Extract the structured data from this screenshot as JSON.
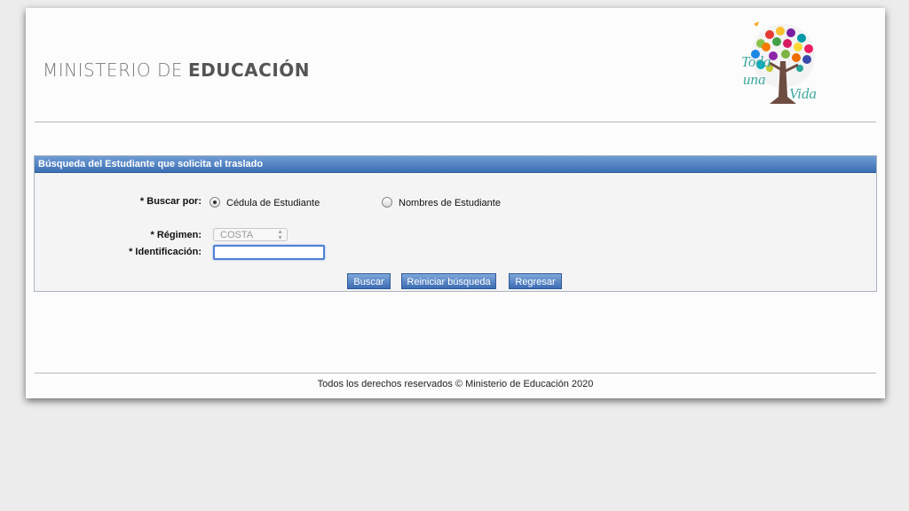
{
  "header": {
    "brand_light": "MINISTERIO DE",
    "brand_bold": "EDUCACIÓN",
    "logo_text_1": "Toda",
    "logo_text_2": "una",
    "logo_text_3": "Vida",
    "logo_icon": "tree-logo-icon"
  },
  "form": {
    "title": "Búsqueda del Estudiante que solicita el traslado",
    "buscar_por_label": "* Buscar por:",
    "radio_cedula": "Cédula de Estudiante",
    "radio_nombres": "Nombres de Estudiante",
    "selected_option": "Cédula de Estudiante",
    "regimen_label": "* Régimen:",
    "regimen_value": "COSTA",
    "identificacion_label": "* Identificación:",
    "identificacion_value": "",
    "buttons": {
      "buscar": "Buscar",
      "reiniciar": "Reiniciar búsqueda",
      "regresar": "Regresar"
    }
  },
  "footer": {
    "text": "Todos los derechos reservados © Ministerio de Educación 2020"
  },
  "colors": {
    "panel_header": "#3c6fb4",
    "button": "#4a77bb",
    "page_bg": "#fcfcfc"
  }
}
